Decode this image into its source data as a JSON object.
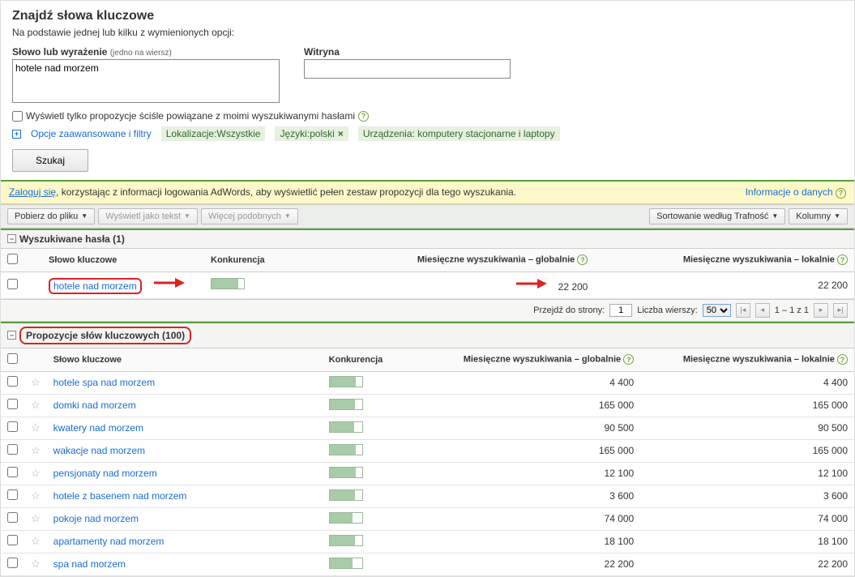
{
  "header": {
    "title": "Znajdź słowa kluczowe",
    "subtitle": "Na podstawie jednej lub kilku z wymienionych opcji:"
  },
  "form": {
    "phrase_label": "Słowo lub wyrażenie",
    "phrase_hint": "(jedno na wiersz)",
    "phrase_value": "hotele nad morzem",
    "site_label": "Witryna",
    "site_value": "",
    "strict_checkbox_label": "Wyświetl tylko propozycje ściśle powiązane z moimi wyszukiwanymi hasłami",
    "advanced_label": "Opcje zaawansowane i filtry",
    "tags": {
      "location": "Lokalizacje:Wszystkie",
      "language": "Języki:polski",
      "devices": "Urządzenia: komputery stacjonarne i laptopy"
    },
    "search_btn": "Szukaj"
  },
  "login_bar": {
    "link": "Zaloguj się",
    "text": ", korzystając z informacji logowania AdWords, aby wyświetlić pełen zestaw propozycji dla tego wyszukania.",
    "info_link": "Informacje o danych"
  },
  "toolbar": {
    "download": "Pobierz do pliku",
    "view_text": "Wyświetl jako tekst",
    "more_similar": "Więcej podobnych",
    "sort": "Sortowanie według Trafność",
    "columns": "Kolumny"
  },
  "searched": {
    "header": "Wyszukiwane hasła (1)",
    "columns": {
      "keyword": "Słowo kluczowe",
      "competition": "Konkurencja",
      "global": "Miesięczne wyszukiwania – globalnie",
      "local": "Miesięczne wyszukiwania – lokalnie"
    },
    "row": {
      "keyword": "hotele nad morzem",
      "comp_pct": 82,
      "global": "22 200",
      "local": "22 200"
    }
  },
  "pagination": {
    "goto_label": "Przejdź do strony:",
    "page": "1",
    "rows_label": "Liczba wierszy:",
    "rows_value": "50",
    "range": "1 – 1 z 1"
  },
  "suggestions": {
    "header": "Propozycje słów kluczowych (100)",
    "columns": {
      "keyword": "Słowo kluczowe",
      "competition": "Konkurencja",
      "global": "Miesięczne wyszukiwania – globalnie",
      "local": "Miesięczne wyszukiwania – lokalnie"
    },
    "rows": [
      {
        "keyword": "hotele spa nad morzem",
        "comp_pct": 80,
        "global": "4 400",
        "local": "4 400"
      },
      {
        "keyword": "domki nad morzem",
        "comp_pct": 78,
        "global": "165 000",
        "local": "165 000"
      },
      {
        "keyword": "kwatery nad morzem",
        "comp_pct": 75,
        "global": "90 500",
        "local": "90 500"
      },
      {
        "keyword": "wakacje nad morzem",
        "comp_pct": 82,
        "global": "165 000",
        "local": "165 000"
      },
      {
        "keyword": "pensjonaty nad morzem",
        "comp_pct": 80,
        "global": "12 100",
        "local": "12 100"
      },
      {
        "keyword": "hotele z basenem nad morzem",
        "comp_pct": 78,
        "global": "3 600",
        "local": "3 600"
      },
      {
        "keyword": "pokoje nad morzem",
        "comp_pct": 70,
        "global": "74 000",
        "local": "74 000"
      },
      {
        "keyword": "apartamenty nad morzem",
        "comp_pct": 78,
        "global": "18 100",
        "local": "18 100"
      },
      {
        "keyword": "spa nad morzem",
        "comp_pct": 72,
        "global": "22 200",
        "local": "22 200"
      }
    ]
  }
}
